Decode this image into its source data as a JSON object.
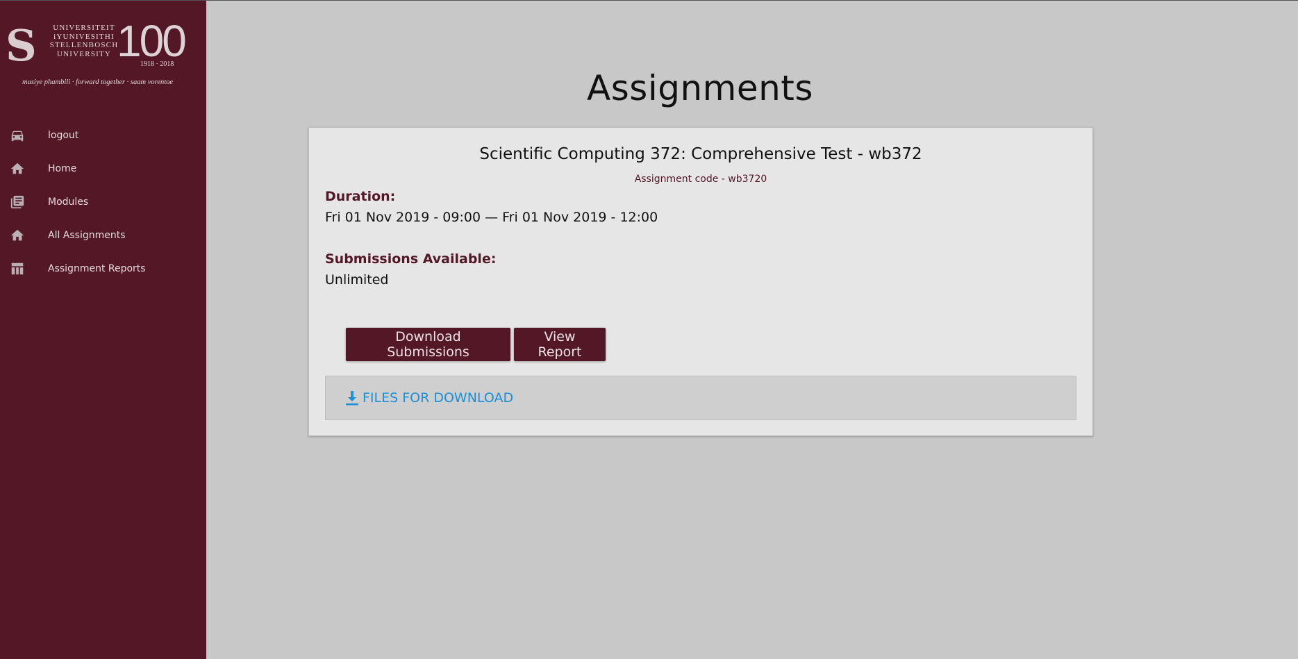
{
  "branding": {
    "logo_lines": [
      "UNIVERSITEIT",
      "iYUNIVESITHI",
      "STELLENBOSCH",
      "UNIVERSITY"
    ],
    "logo_number": "100",
    "logo_years": "1918 · 2018",
    "motto": "masiye phambili · forward together · saam vorentoe"
  },
  "sidebar": {
    "items": [
      {
        "label": "logout",
        "icon": "car-icon"
      },
      {
        "label": "Home",
        "icon": "home-icon"
      },
      {
        "label": "Modules",
        "icon": "library-books-icon"
      },
      {
        "label": "All Assignments",
        "icon": "home-icon"
      },
      {
        "label": "Assignment Reports",
        "icon": "table-icon"
      }
    ]
  },
  "main": {
    "title": "Assignments",
    "assignment": {
      "title": "Scientific Computing 372: Comprehensive Test - wb372",
      "code": "Assignment code - wb3720",
      "duration_label": "Duration:",
      "duration_value": "Fri 01 Nov 2019 - 09:00 — Fri 01 Nov 2019 - 12:00",
      "submissions_label": "Submissions Available:",
      "submissions_value": "Unlimited",
      "download_submissions_label": "Download Submissions",
      "view_report_label": "View Report",
      "files_label": "FILES FOR DOWNLOAD"
    }
  },
  "colors": {
    "brand": "#541726",
    "background": "#c8c8c8",
    "card": "#e6e6e6",
    "link": "#1c8fd6"
  }
}
